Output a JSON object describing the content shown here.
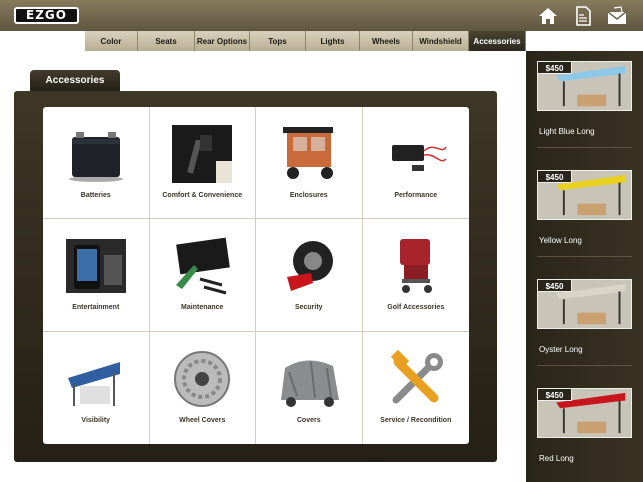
{
  "header": {
    "logo_text": "EZGO",
    "icons": [
      "home-icon",
      "document-icon",
      "mail-icon"
    ]
  },
  "tabs": [
    {
      "label": "Color",
      "active": false
    },
    {
      "label": "Seats",
      "active": false
    },
    {
      "label": "Rear Options",
      "active": false
    },
    {
      "label": "Tops",
      "active": false
    },
    {
      "label": "Lights",
      "active": false
    },
    {
      "label": "Wheels",
      "active": false
    },
    {
      "label": "Windshield",
      "active": false
    },
    {
      "label": "Accessories",
      "active": true
    }
  ],
  "section": {
    "title": "Accessories"
  },
  "categories": [
    {
      "label": "Batteries",
      "icon": "battery-icon"
    },
    {
      "label": "Comfort & Convenience",
      "icon": "comfort-icon"
    },
    {
      "label": "Enclosures",
      "icon": "enclosure-icon"
    },
    {
      "label": "Performance",
      "icon": "performance-icon"
    },
    {
      "label": "Entertainment",
      "icon": "entertainment-icon"
    },
    {
      "label": "Maintenance",
      "icon": "maintenance-icon"
    },
    {
      "label": "Security",
      "icon": "security-icon"
    },
    {
      "label": "Golf Accessories",
      "icon": "golf-icon"
    },
    {
      "label": "Visibility",
      "icon": "visibility-icon"
    },
    {
      "label": "Wheel Covers",
      "icon": "wheel-cover-icon"
    },
    {
      "label": "Covers",
      "icon": "cover-icon"
    },
    {
      "label": "Service / Recondition",
      "icon": "tools-icon"
    }
  ],
  "sidebar": {
    "items": [
      {
        "price": "$450",
        "label": "Light Blue Long",
        "color": "#8ec8e8"
      },
      {
        "price": "$450",
        "label": "Yellow Long",
        "color": "#e8d020"
      },
      {
        "price": "$450",
        "label": "Oyster Long",
        "color": "#d8d4c6"
      },
      {
        "price": "$450",
        "label": "Red Long",
        "color": "#c8161c"
      }
    ]
  },
  "colors": {
    "accent": "#2d281d",
    "header": "#6f654b",
    "tabbar": "#c9c0a6"
  }
}
